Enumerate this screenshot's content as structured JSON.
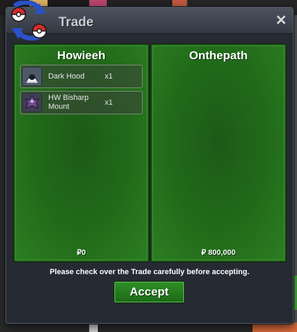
{
  "window": {
    "title": "Trade",
    "close_glyph": "✕"
  },
  "left_panel": {
    "player_name": "Howieeh",
    "items": [
      {
        "name": "Dark Hood",
        "quantity": "x1",
        "icon": "dark-hood-icon"
      },
      {
        "name": "HW Bisharp Mount",
        "quantity": "x1",
        "icon": "bisharp-mount-icon"
      }
    ],
    "money": "₽0"
  },
  "right_panel": {
    "player_name": "Onthepath",
    "items": [],
    "money": "₽ 800,000"
  },
  "notice": "Please check over the Trade carefully before accepting.",
  "accept_label": "Accept",
  "colors": {
    "panel_green": "#226b1a",
    "accept_green": "#2e8f27",
    "window_bg": "#262a33",
    "logo_red": "#d42a2a",
    "logo_blue": "#2a52c8"
  }
}
